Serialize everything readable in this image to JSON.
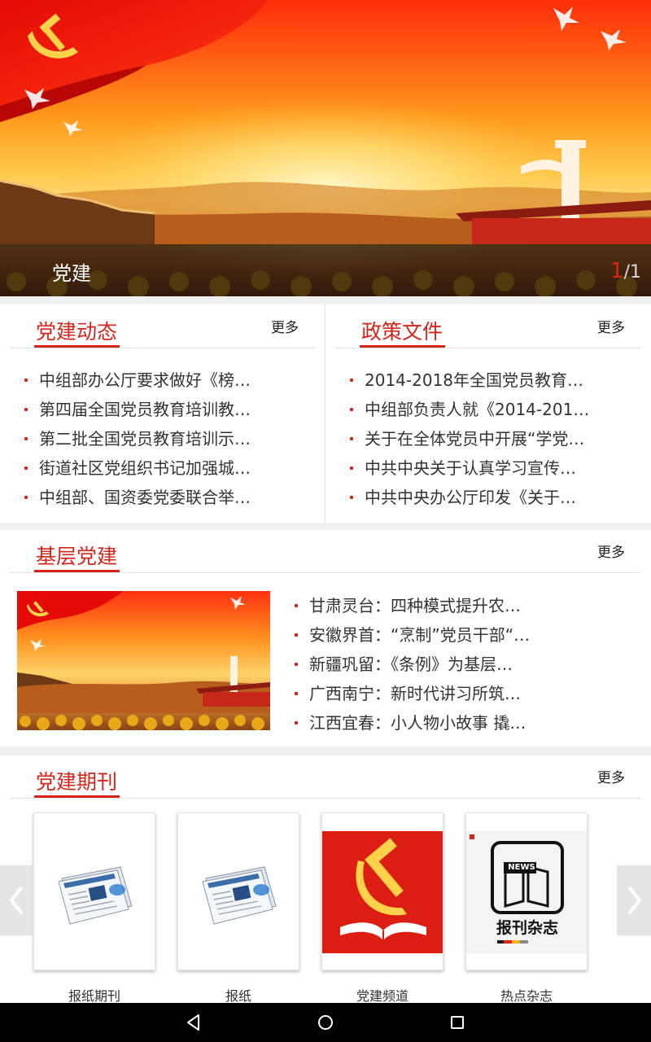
{
  "banner": {
    "title": "党建",
    "counter_current": "1",
    "counter_total": "/1"
  },
  "dangjian_dongtai": {
    "title": "党建动态",
    "more": "更多",
    "items": [
      "中组部办公厅要求做好《榜…",
      "第四届全国党员教育培训教…",
      "第二批全国党员教育培训示…",
      "街道社区党组织书记加强城…",
      "中组部、国资委党委联合举…"
    ]
  },
  "zhengce_wenjian": {
    "title": "政策文件",
    "more": "更多",
    "items": [
      "2014-2018年全国党员教育…",
      "中组部负责人就《2014-201…",
      "关于在全体党员中开展“学党…",
      "中共中央关于认真学习宣传…",
      "中共中央办公厅印发《关于…"
    ]
  },
  "jiceng_dangjian": {
    "title": "基层党建",
    "more": "更多",
    "items": [
      "甘肃灵台：四种模式提升农…",
      "安徽界首：“烹制”党员干部“…",
      "新疆巩留：《条例》为基层…",
      "广西南宁：新时代讲习所筑…",
      "江西宜春：小人物小故事 撬…"
    ]
  },
  "dangjian_qikan": {
    "title": "党建期刊",
    "more": "更多",
    "journals": [
      {
        "label": "报纸期刊",
        "icon": "newspaper-icon"
      },
      {
        "label": "报纸",
        "icon": "newspaper-icon"
      },
      {
        "label": "党建频道",
        "icon": "party-emblem-icon"
      },
      {
        "label": "热点杂志",
        "icon": "news-magazine-icon",
        "cover_text": "报刊杂志",
        "cover_badge": "NEWS"
      }
    ]
  },
  "colors": {
    "accent": "#d4251b",
    "text": "#333333",
    "background": "#efefef"
  }
}
